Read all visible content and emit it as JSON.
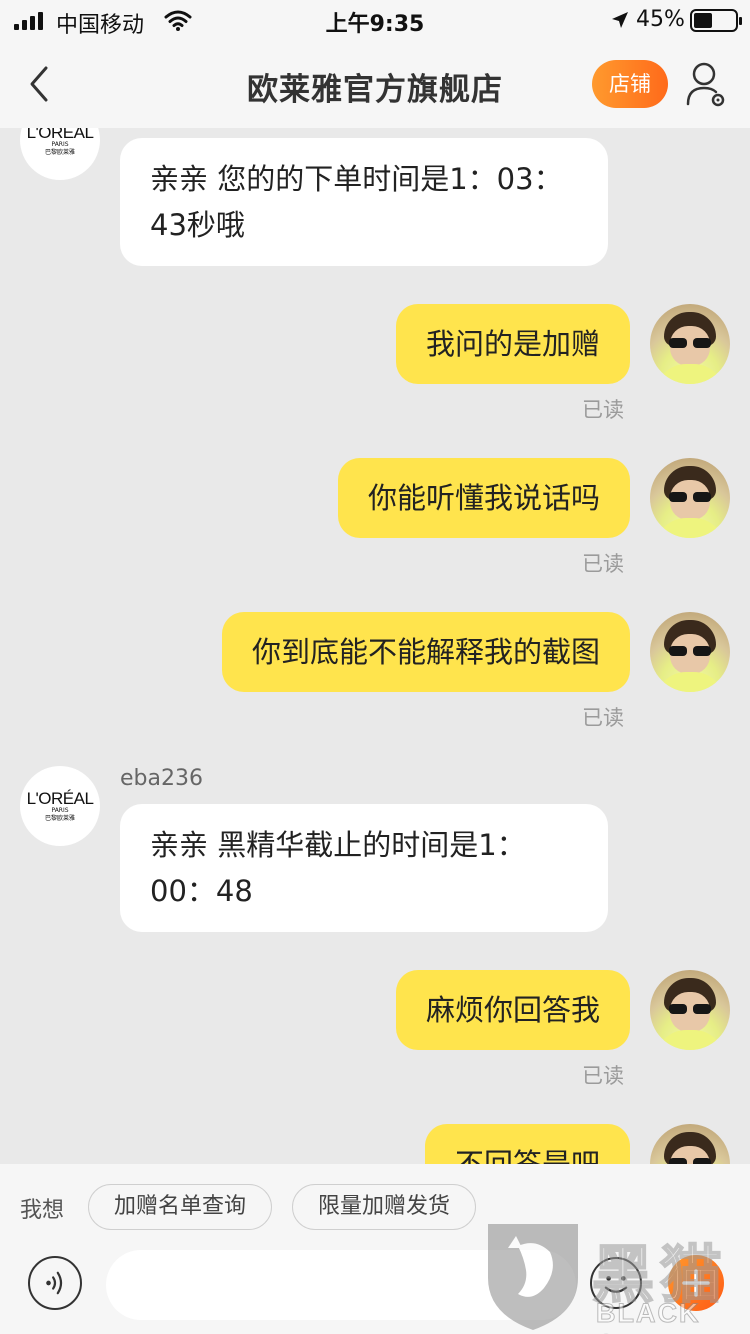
{
  "status_bar": {
    "carrier": "中国移动",
    "time": "上午9:35",
    "battery": "45%"
  },
  "nav": {
    "title": "欧莱雅官方旗舰店",
    "shop_label": "店铺"
  },
  "brand_avatar": {
    "main": "L'ORÉAL",
    "sub": "PARIS",
    "cn": "巴黎欧莱雅"
  },
  "messages": [
    {
      "from": "shop",
      "text": "亲亲 您的的下单时间是1：03：43秒哦"
    },
    {
      "from": "user",
      "text": "我问的是加赠",
      "status": "已读"
    },
    {
      "from": "user",
      "text": "你能听懂我说话吗",
      "status": "已读"
    },
    {
      "from": "user",
      "text": "你到底能不能解释我的截图",
      "status": "已读"
    },
    {
      "from": "shop",
      "sender": "eba236",
      "text": "亲亲 黑精华截止的时间是1：00：48"
    },
    {
      "from": "user",
      "text": "麻烦你回答我",
      "status": "已读"
    },
    {
      "from": "user",
      "text": "不回答是吧"
    }
  ],
  "quick_replies": {
    "label": "我想",
    "items": [
      "加赠名单查询",
      "限量加赠发货"
    ]
  },
  "input": {
    "placeholder": ""
  },
  "watermark": {
    "cn": "黑猫",
    "en": "BLACK CAT"
  }
}
